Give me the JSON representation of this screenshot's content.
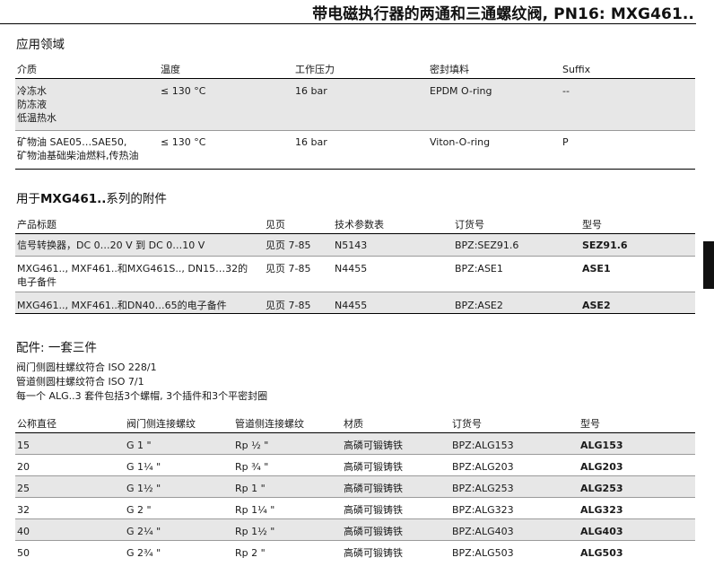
{
  "page_title": "带电磁执行器的两通和三通螺纹阀, PN16: MXG461..",
  "applications": {
    "heading": "应用领域",
    "columns": [
      "介质",
      "温度",
      "工作压力",
      "密封填料",
      "Suffix"
    ],
    "rows": [
      {
        "medium": [
          "冷冻水",
          "防冻液",
          "低温热水"
        ],
        "temperature": "≤ 130 °C",
        "pressure": "16 bar",
        "seal": "EPDM O-ring",
        "suffix": "--"
      },
      {
        "medium": [
          "矿物油 SAE05…SAE50,",
          "矿物油基础柴油燃料,传热油"
        ],
        "temperature": "≤ 130 °C",
        "pressure": "16 bar",
        "seal": "Viton-O-ring",
        "suffix": "P"
      }
    ]
  },
  "accessories": {
    "heading_prefix": "用于",
    "heading_model": "MXG461..",
    "heading_suffix": "系列的附件",
    "columns": [
      "产品标题",
      "见页",
      "技术参数表",
      "订货号",
      "型号"
    ],
    "rows": [
      {
        "title": [
          "信号转换器，DC 0…20 V 到 DC 0…10 V"
        ],
        "page": "见页 7-85",
        "datasheet": "N5143",
        "order_no": "BPZ:SEZ91.6",
        "type": "SEZ91.6"
      },
      {
        "title": [
          "MXG461.., MXF461..和MXG461S.., DN15…32的",
          "电子备件"
        ],
        "page": "见页 7-85",
        "datasheet": "N4455",
        "order_no": "BPZ:ASE1",
        "type": "ASE1"
      },
      {
        "title": [
          "MXG461.., MXF461..和DN40…65的电子备件"
        ],
        "page": "见页 7-85",
        "datasheet": "N4455",
        "order_no": "BPZ:ASE2",
        "type": "ASE2"
      }
    ]
  },
  "fittings": {
    "heading": "配件: 一套三件",
    "notes": [
      "阀门侧圆柱螺纹符合 ISO 228/1",
      "管道侧圆柱螺纹符合 ISO 7/1",
      "每一个 ALG..3 套件包括3个螺帽, 3个插件和3个平密封圈"
    ],
    "columns": [
      "公称直径",
      "阀门侧连接螺纹",
      "管道侧连接螺纹",
      "材质",
      "订货号",
      "型号"
    ],
    "rows": [
      {
        "dn": "15",
        "valve_thread": "G 1 \"",
        "pipe_thread": "Rp ½ \"",
        "material": "高磷可锻铸铁",
        "order_no": "BPZ:ALG153",
        "type": "ALG153"
      },
      {
        "dn": "20",
        "valve_thread": "G 1¼ \"",
        "pipe_thread": "Rp ¾ \"",
        "material": "高磷可锻铸铁",
        "order_no": "BPZ:ALG203",
        "type": "ALG203"
      },
      {
        "dn": "25",
        "valve_thread": "G 1½ \"",
        "pipe_thread": "Rp 1 \"",
        "material": "高磷可锻铸铁",
        "order_no": "BPZ:ALG253",
        "type": "ALG253"
      },
      {
        "dn": "32",
        "valve_thread": "G 2 \"",
        "pipe_thread": "Rp 1¼ \"",
        "material": "高磷可锻铸铁",
        "order_no": "BPZ:ALG323",
        "type": "ALG323"
      },
      {
        "dn": "40",
        "valve_thread": "G 2¼ \"",
        "pipe_thread": "Rp 1½ \"",
        "material": "高磷可锻铸铁",
        "order_no": "BPZ:ALG403",
        "type": "ALG403"
      },
      {
        "dn": "50",
        "valve_thread": "G 2¾ \"",
        "pipe_thread": "Rp 2 \"",
        "material": "高磷可锻铸铁",
        "order_no": "BPZ:ALG503",
        "type": "ALG503"
      }
    ]
  }
}
